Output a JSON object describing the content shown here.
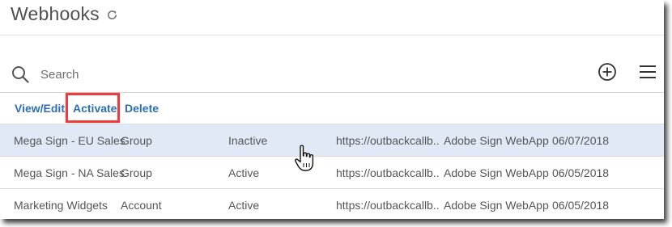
{
  "page": {
    "title": "Webhooks"
  },
  "search": {
    "placeholder": "Search"
  },
  "actions": {
    "view_edit": "View/Edit",
    "activate": "Activate",
    "delete": "Delete"
  },
  "rows": [
    {
      "name": "Mega Sign - EU Sales",
      "scope": "Group",
      "status": "Inactive",
      "url": "https://outbackcallb...",
      "application": "Adobe Sign WebApp",
      "date": "06/07/2018",
      "selected": true
    },
    {
      "name": "Mega Sign - NA Sales",
      "scope": "Group",
      "status": "Active",
      "url": "https://outbackcallb...",
      "application": "Adobe Sign WebApp",
      "date": "06/05/2018",
      "selected": false
    },
    {
      "name": "Marketing Widgets",
      "scope": "Account",
      "status": "Active",
      "url": "https://outbackcallb...",
      "application": "Adobe Sign WebApp",
      "date": "06/05/2018",
      "selected": false
    }
  ],
  "icons": {
    "refresh": "refresh-icon",
    "search": "search-icon",
    "add": "add-circle-icon",
    "menu": "hamburger-menu-icon",
    "cursor": "hand-pointer-cursor-icon"
  },
  "colors": {
    "link": "#2c6fb6",
    "selected_row": "#dfeaf6",
    "highlight_box": "#ee3b3b",
    "text": "#555555"
  }
}
